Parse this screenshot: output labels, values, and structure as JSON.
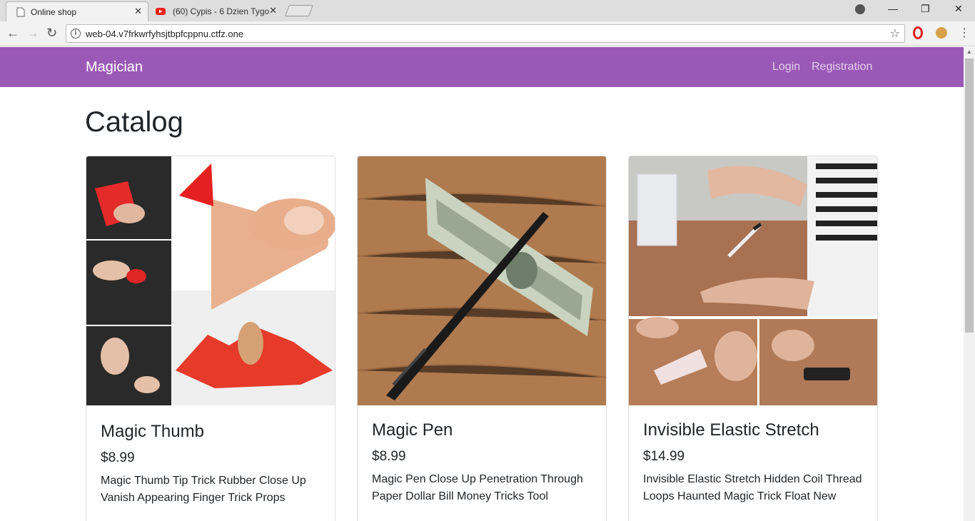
{
  "browser": {
    "tabs": [
      {
        "title": "Online shop",
        "active": true
      },
      {
        "title": "(60) Cypis - 6 Dzien Tygo",
        "active": false
      }
    ],
    "url": "web-04.v7frkwrfyhsjtbpfcppnu.ctfz.one"
  },
  "navbar": {
    "brand": "Magician",
    "links": [
      "Login",
      "Registration"
    ],
    "color": "#9b59b6"
  },
  "page": {
    "heading": "Catalog"
  },
  "products": [
    {
      "name": "Magic Thumb",
      "price": "$8.99",
      "description": "Magic Thumb Tip Trick Rubber Close Up Vanish Appearing Finger Trick Props",
      "image": "magic-thumb-photo"
    },
    {
      "name": "Magic Pen",
      "price": "$8.99",
      "description": "Magic Pen Close Up Penetration Through Paper Dollar Bill Money Tricks Tool",
      "image": "magic-pen-photo"
    },
    {
      "name": "Invisible Elastic Stretch",
      "price": "$14.99",
      "description": "Invisible Elastic Stretch Hidden Coil Thread Loops Haunted Magic Trick Float New",
      "image": "invisible-elastic-photo"
    }
  ]
}
